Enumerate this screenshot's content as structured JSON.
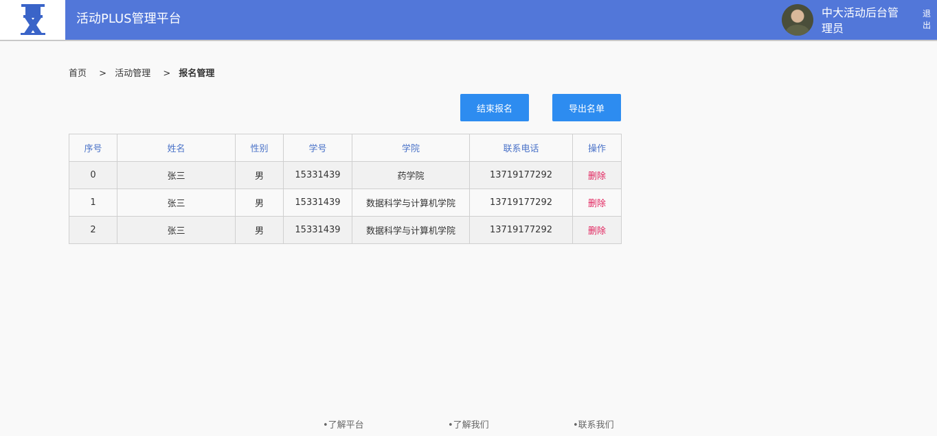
{
  "header": {
    "app_title": "活动PLUS管理平台",
    "user_name": "中大活动后台管理员",
    "logout_label": "退出",
    "logo_icon": "chair-logo-icon"
  },
  "breadcrumb": {
    "items": [
      "首页",
      "活动管理",
      "报名管理"
    ],
    "separator": ">"
  },
  "actions": {
    "end_label": "结束报名",
    "export_label": "导出名单"
  },
  "table": {
    "columns": [
      "序号",
      "姓名",
      "性别",
      "学号",
      "学院",
      "联系电话",
      "操作"
    ],
    "rows": [
      {
        "index": "0",
        "name": "张三",
        "gender": "男",
        "student_id": "15331439",
        "school": "药学院",
        "phone": "13719177292",
        "action": "删除"
      },
      {
        "index": "1",
        "name": "张三",
        "gender": "男",
        "student_id": "15331439",
        "school": "数据科学与计算机学院",
        "phone": "13719177292",
        "action": "删除"
      },
      {
        "index": "2",
        "name": "张三",
        "gender": "男",
        "student_id": "15331439",
        "school": "数据科学与计算机学院",
        "phone": "13719177292",
        "action": "删除"
      }
    ]
  },
  "footer": {
    "links": [
      "•了解平台",
      "•了解我们",
      "•联系我们"
    ]
  },
  "colors": {
    "header_bg": "#5277d9",
    "button_bg": "#2d8cf0",
    "column_header_text": "#4a72c8",
    "delete_text": "#e2245e"
  }
}
